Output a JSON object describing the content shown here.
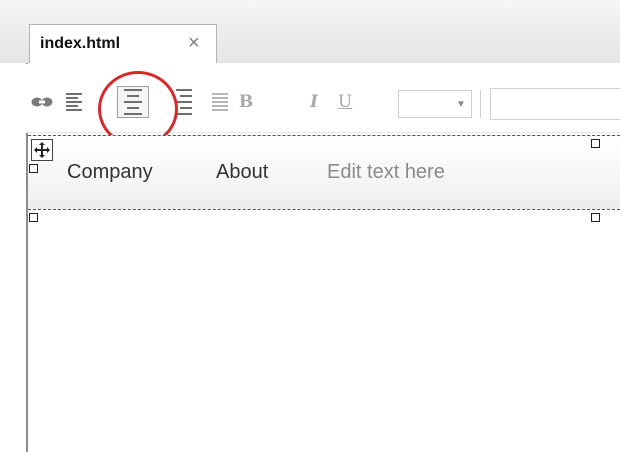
{
  "tabs": [
    {
      "label": "index.html",
      "close_glyph": "×"
    }
  ],
  "toolbar": {
    "buttons": [
      {
        "name": "link-icon",
        "state": "normal"
      },
      {
        "name": "align-left-icon",
        "state": "normal"
      },
      {
        "name": "align-center-icon",
        "state": "active"
      },
      {
        "name": "align-right-icon",
        "state": "normal"
      },
      {
        "name": "align-justify-icon",
        "state": "disabled"
      },
      {
        "name": "bold-button",
        "label": "B",
        "state": "disabled"
      },
      {
        "name": "italic-button",
        "label": "I",
        "state": "disabled"
      },
      {
        "name": "underline-button",
        "label": "U",
        "state": "disabled"
      }
    ],
    "color_dropdown": {
      "value": "",
      "arrow_icon": "chevron-down-icon"
    },
    "font_field": {
      "value": ""
    },
    "highlight_color": "#d42a2a"
  },
  "canvas": {
    "nav": {
      "items": [
        "Company",
        "About"
      ],
      "placeholder": "Edit text here"
    },
    "move_handle_icon": "move-icon"
  }
}
